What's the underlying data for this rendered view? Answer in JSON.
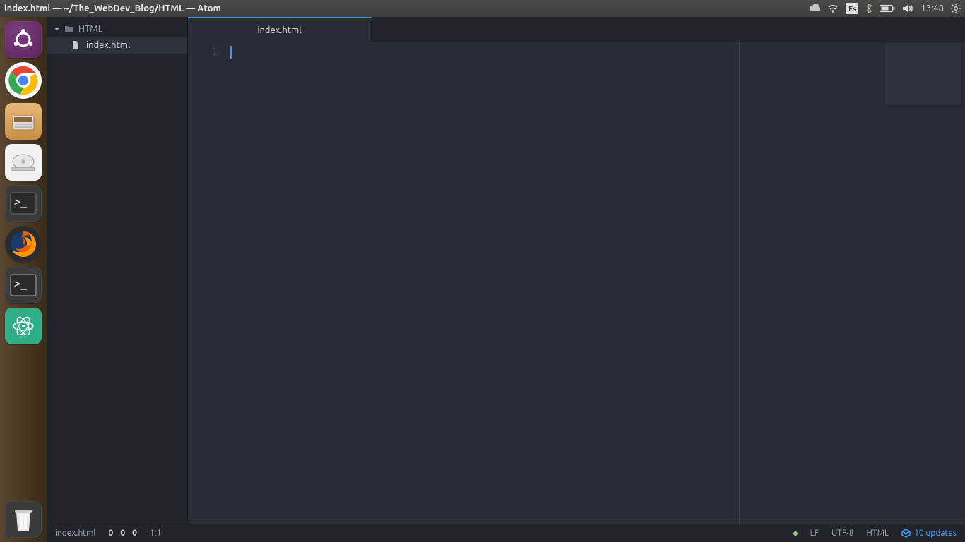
{
  "menubar": {
    "title": "index.html — ~/The_WebDev_Blog/HTML — Atom",
    "keyboard_layout": "Es",
    "clock": "13:48"
  },
  "launcher": {
    "items": [
      {
        "id": "ubuntu-dash"
      },
      {
        "id": "chrome"
      },
      {
        "id": "files"
      },
      {
        "id": "disks"
      },
      {
        "id": "terminal"
      },
      {
        "id": "firefox"
      },
      {
        "id": "terminal-root"
      },
      {
        "id": "atom",
        "active": true
      }
    ],
    "trash": {
      "id": "trash"
    }
  },
  "tree": {
    "root_label": "HTML",
    "files": [
      {
        "label": "index.html"
      }
    ]
  },
  "tabs": [
    {
      "label": "index.html"
    }
  ],
  "editor": {
    "line_numbers": [
      "1"
    ]
  },
  "status": {
    "filename": "index.html",
    "counts": [
      "0",
      "0",
      "0"
    ],
    "cursor_position": "1:1",
    "line_ending": "LF",
    "encoding": "UTF-8",
    "grammar": "HTML",
    "updates_label": "10 updates"
  }
}
